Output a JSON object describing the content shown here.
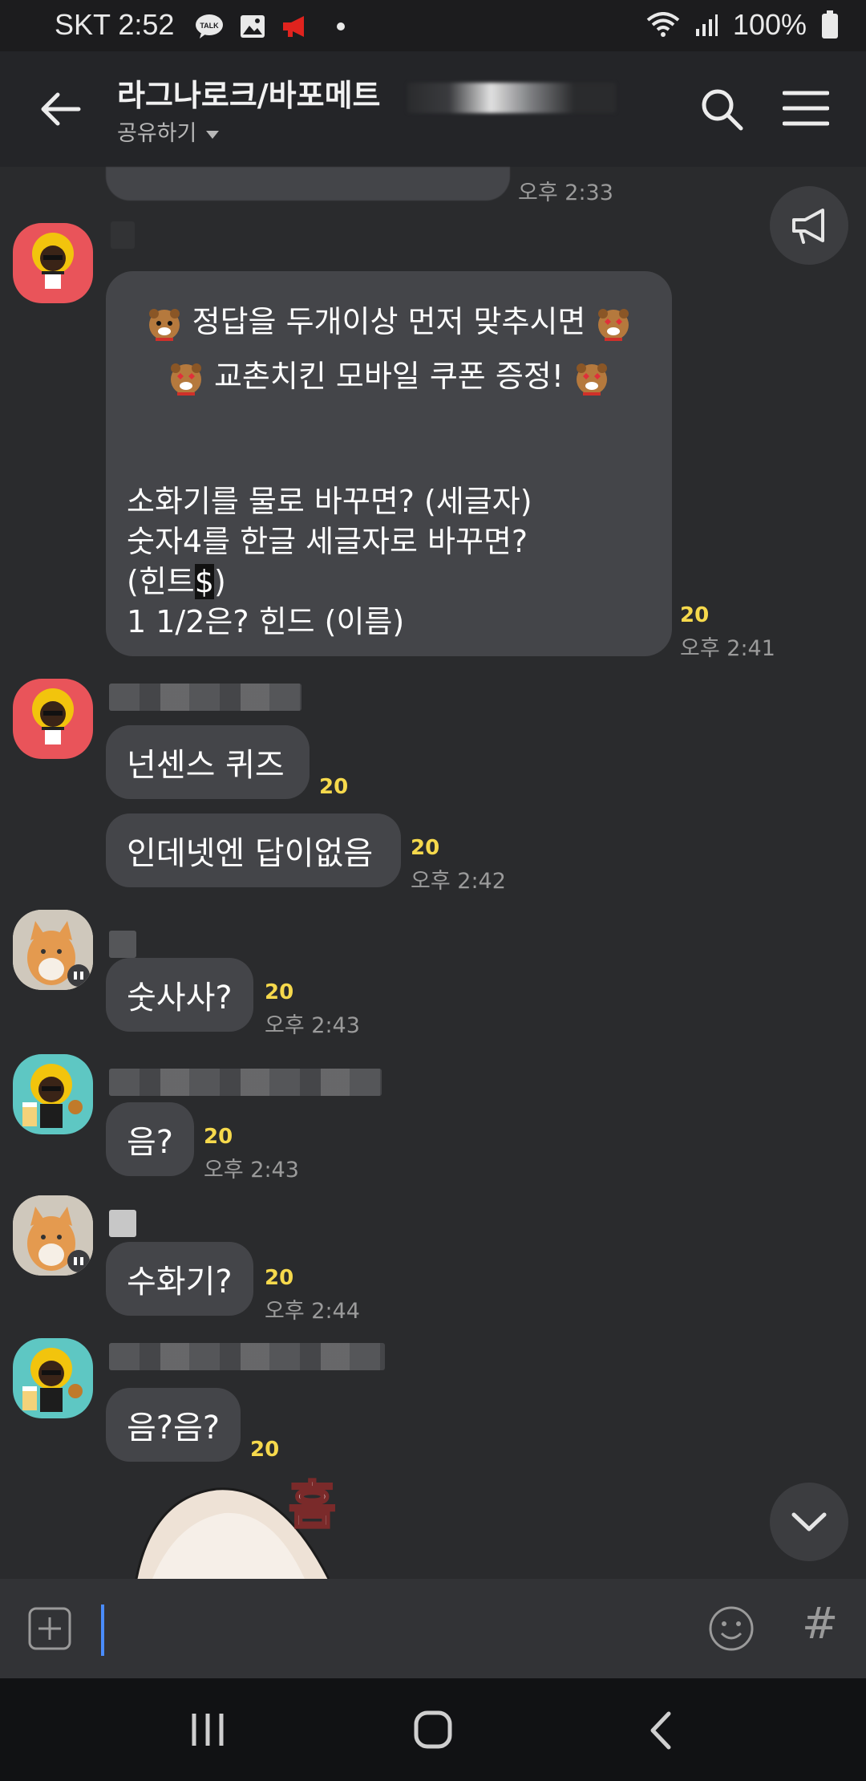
{
  "status_bar": {
    "carrier_time": "SKT 2:52",
    "battery": "100%"
  },
  "header": {
    "title": "라그나로크/바포메트",
    "share_label": "공유하기"
  },
  "big_message": {
    "line1": "정답을 두개이상 먼저 맞추시면",
    "line2": "교촌치킨 모바일 쿠폰 증정!",
    "line3": "소화기를 물로 바꾸면? (세글자)",
    "line4": "숫자4를 한글 세글자로 바꾸면?",
    "line5_a": "(힌트",
    "line5_b": "$",
    "line5_c": ")",
    "line6": "1 1/2은? 힌드 (이름)",
    "count": "20",
    "time": "오후 2:41"
  },
  "top_partial": {
    "time": "오후 2:33"
  },
  "messages": [
    {
      "text": "넌센스 퀴즈",
      "count": "20",
      "time": ""
    },
    {
      "text": "인데넷엔 답이없음",
      "count": "20",
      "time": "오후 2:42"
    },
    {
      "text": "숫사사?",
      "count": "20",
      "time": "오후 2:43"
    },
    {
      "text": "음?",
      "count": "20",
      "time": "오후 2:43"
    },
    {
      "text": "수화기?",
      "count": "20",
      "time": "오후 2:44"
    },
    {
      "text": "음?음?",
      "count": "20",
      "time": ""
    }
  ],
  "sticker_text": "흠",
  "icons": {
    "back": "arrow-left-icon",
    "search": "search-icon",
    "menu": "menu-icon",
    "notice": "megaphone-icon",
    "scroll": "chevron-down-icon",
    "plus": "plus-icon",
    "emoji": "smile-icon",
    "hash": "hash-icon"
  },
  "colors": {
    "background": "#2a2b2d",
    "bubble": "#444549",
    "count": "#f6d94c",
    "cursor": "#4a8cff"
  },
  "input": {
    "hash_label": "#"
  }
}
